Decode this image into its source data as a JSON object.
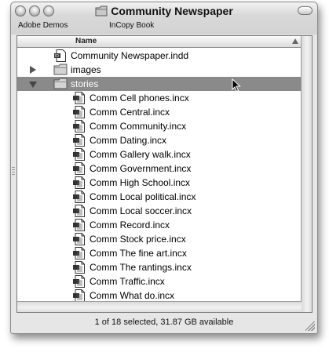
{
  "window": {
    "title": "Community Newspaper",
    "toolbar": [
      "Adobe Demos",
      "InCopy Book"
    ]
  },
  "list": {
    "column_header": "Name",
    "rows": [
      {
        "label": "Community Newspaper.indd",
        "kind": "indd-doc-icon",
        "level": 0,
        "disclosure": "none",
        "selected": false
      },
      {
        "label": "images",
        "kind": "folder-icon",
        "level": 0,
        "disclosure": "collapsed",
        "selected": false
      },
      {
        "label": "stories",
        "kind": "folder-icon",
        "level": 0,
        "disclosure": "expanded",
        "selected": true
      },
      {
        "label": "Comm Cell phones.incx",
        "kind": "incx-doc-icon",
        "level": 1,
        "disclosure": "none",
        "selected": false
      },
      {
        "label": "Comm Central.incx",
        "kind": "incx-doc-icon",
        "level": 1,
        "disclosure": "none",
        "selected": false
      },
      {
        "label": "Comm Community.incx",
        "kind": "incx-doc-icon",
        "level": 1,
        "disclosure": "none",
        "selected": false
      },
      {
        "label": "Comm Dating.incx",
        "kind": "incx-doc-icon",
        "level": 1,
        "disclosure": "none",
        "selected": false
      },
      {
        "label": "Comm Gallery walk.incx",
        "kind": "incx-doc-icon",
        "level": 1,
        "disclosure": "none",
        "selected": false
      },
      {
        "label": "Comm Government.incx",
        "kind": "incx-doc-icon",
        "level": 1,
        "disclosure": "none",
        "selected": false
      },
      {
        "label": "Comm High School.incx",
        "kind": "incx-doc-icon",
        "level": 1,
        "disclosure": "none",
        "selected": false
      },
      {
        "label": "Comm Local political.incx",
        "kind": "incx-doc-icon",
        "level": 1,
        "disclosure": "none",
        "selected": false
      },
      {
        "label": "Comm Local soccer.incx",
        "kind": "incx-doc-icon",
        "level": 1,
        "disclosure": "none",
        "selected": false
      },
      {
        "label": "Comm Record.incx",
        "kind": "incx-doc-icon",
        "level": 1,
        "disclosure": "none",
        "selected": false
      },
      {
        "label": "Comm Stock price.incx",
        "kind": "incx-doc-icon",
        "level": 1,
        "disclosure": "none",
        "selected": false
      },
      {
        "label": "Comm The fine art.incx",
        "kind": "incx-doc-icon",
        "level": 1,
        "disclosure": "none",
        "selected": false
      },
      {
        "label": "Comm The rantings.incx",
        "kind": "incx-doc-icon",
        "level": 1,
        "disclosure": "none",
        "selected": false
      },
      {
        "label": "Comm Traffic.incx",
        "kind": "incx-doc-icon",
        "level": 1,
        "disclosure": "none",
        "selected": false
      },
      {
        "label": "Comm What do.incx",
        "kind": "incx-doc-icon",
        "level": 1,
        "disclosure": "none",
        "selected": false
      }
    ]
  },
  "status": "1 of 18 selected, 31.87 GB available",
  "colors": {
    "selection": "#8a8a8a",
    "selection_text": "#ffffff"
  }
}
